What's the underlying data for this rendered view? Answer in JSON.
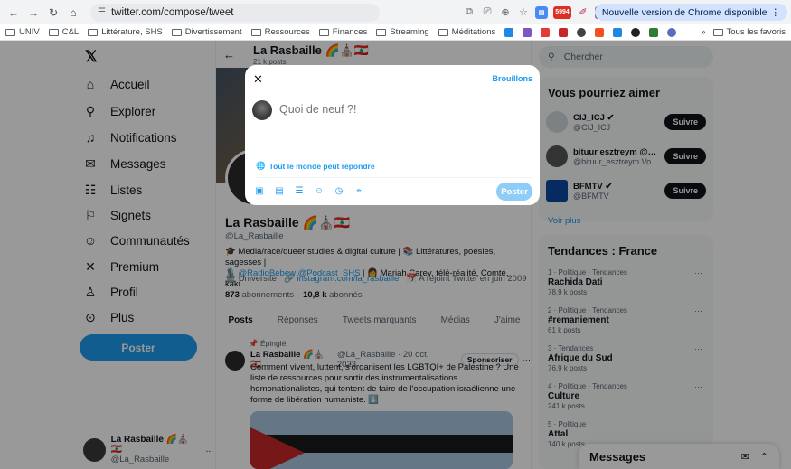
{
  "browser": {
    "url": "twitter.com/compose/tweet",
    "update_label": "Nouvelle version de Chrome disponible",
    "ext_badge": "5994"
  },
  "bookmarks": {
    "items": [
      "UNIV",
      "C&L",
      "Littérature, SHS",
      "Divertissement",
      "Ressources",
      "Finances",
      "Streaming",
      "Méditations"
    ],
    "overflow": "»",
    "all_label": "Tous les favoris"
  },
  "nav": {
    "items": [
      {
        "label": "Accueil",
        "icon": "home-icon"
      },
      {
        "label": "Explorer",
        "icon": "search-icon"
      },
      {
        "label": "Notifications",
        "icon": "bell-icon"
      },
      {
        "label": "Messages",
        "icon": "envelope-icon"
      },
      {
        "label": "Listes",
        "icon": "list-icon"
      },
      {
        "label": "Signets",
        "icon": "bookmark-icon"
      },
      {
        "label": "Communautés",
        "icon": "people-icon"
      },
      {
        "label": "Premium",
        "icon": "x-icon"
      },
      {
        "label": "Profil",
        "icon": "person-icon"
      },
      {
        "label": "Plus",
        "icon": "more-icon"
      }
    ],
    "post_button": "Poster",
    "account_name": "La Rasbaille 🌈⛪🇱🇧",
    "account_handle": "@La_Rasbaille",
    "account_more": "..."
  },
  "profile": {
    "header_name": "La Rasbaille 🌈⛪🇱🇧",
    "header_posts": "21 k posts",
    "name": "La Rasbaille 🌈⛪🇱🇧",
    "handle": "@La_Rasbaille",
    "bio_line1": "🎓 Media/race/queer studies & digital culture | 📚 Littératures, poésies, sagesses |",
    "bio_line2_pre": "🎙️ ",
    "bio_links": "@RadioBebew @Podcast_SHS",
    "bio_line2_post": " | 👩 Mariah Carey, télé-réalité, Comté, kaki",
    "meta_work": "🏛 Université",
    "meta_link": "🔗 instagram.com/la_rasbaille",
    "meta_joined": "📅 A rejoint Twitter en juin 2009",
    "following_count": "873",
    "following_label": "abonnements",
    "followers_count": "10,8 k",
    "followers_label": "abonnés",
    "tabs": [
      "Posts",
      "Réponses",
      "Tweets marquants",
      "Médias",
      "J'aime"
    ]
  },
  "tweet": {
    "pinned": "📌 Épinglé",
    "author": "La Rasbaille 🌈⛪🇱🇧",
    "handle_date": "@La_Rasbaille · 20 oct. 2023",
    "sponsor": "Sponsoriser",
    "more": "···",
    "text": "Comment vivent, luttent, s'organisent les LGBTQI+ de Palestine ? Une liste de ressources pour sortir des instrumentalisations homonationalistes, qui tentent de faire de l'occupation israélienne une forme de libération humaniste. ⬇️"
  },
  "right": {
    "search_placeholder": "Chercher",
    "who_title": "Vous pourriez aimer",
    "who": [
      {
        "name": "CIJ_ICJ ✔",
        "handle": "@CIJ_ICJ",
        "button": "Suivre"
      },
      {
        "name": "bituur esztreym @bituur_",
        "handle": "@bituur_esztreym Vous suit",
        "button": "Suivre"
      },
      {
        "name": "BFMTV ✔",
        "handle": "@BFMTV",
        "button": "Suivre"
      }
    ],
    "see_more": "Voir plus",
    "trends_title": "Tendances : France",
    "trends": [
      {
        "context": "1 · Politique · Tendances",
        "name": "Rachida Dati",
        "count": "78,9 k posts"
      },
      {
        "context": "2 · Politique · Tendances",
        "name": "#remaniement",
        "count": "61 k posts"
      },
      {
        "context": "3 · Tendances",
        "name": "Afrique du Sud",
        "count": "76,9 k posts"
      },
      {
        "context": "4 · Politique · Tendances",
        "name": "Culture",
        "count": "241 k posts"
      },
      {
        "context": "5 · Politique",
        "name": "Attal",
        "count": "140 k posts"
      }
    ],
    "trend_more": "···",
    "messages_drawer": "Messages"
  },
  "compose": {
    "drafts": "Brouillons",
    "placeholder": "Quoi de neuf ?!",
    "reply_setting": "Tout le monde peut répondre",
    "post_button": "Poster",
    "tools": [
      "image-icon",
      "gif-icon",
      "poll-icon",
      "emoji-icon",
      "schedule-icon",
      "location-icon"
    ]
  },
  "colors": {
    "accent": "#1d9bf0",
    "overlay": "rgba(0,0,0,0.4)"
  }
}
